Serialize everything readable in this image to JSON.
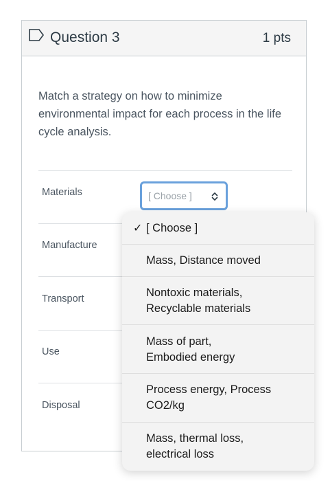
{
  "question": {
    "title": "Question 3",
    "points": "1 pts",
    "text": "Match a strategy on how to minimize environmental impact for each process in the life cycle analysis."
  },
  "rows": [
    {
      "label": "Materials"
    },
    {
      "label": "Manufacture"
    },
    {
      "label": "Transport"
    },
    {
      "label": "Use"
    },
    {
      "label": "Disposal"
    }
  ],
  "select": {
    "current_value": "[ Choose ]"
  },
  "dropdown": {
    "options": [
      {
        "label": "[ Choose ]",
        "selected": true
      },
      {
        "label_line1": "Mass, Distance moved"
      },
      {
        "label_line1": "Nontoxic materials,",
        "label_line2": "Recyclable materials"
      },
      {
        "label_line1": "Mass of part,",
        "label_line2": "Embodied energy"
      },
      {
        "label_line1": "Process energy, Process",
        "label_line2": "CO2/kg"
      },
      {
        "label_line1": "Mass, thermal loss,",
        "label_line2": "electrical loss"
      }
    ],
    "check_mark": "✓"
  },
  "colors": {
    "accent": "#6aa1dc",
    "header_bg": "#f5f5f5",
    "border": "#c7cdd1"
  }
}
